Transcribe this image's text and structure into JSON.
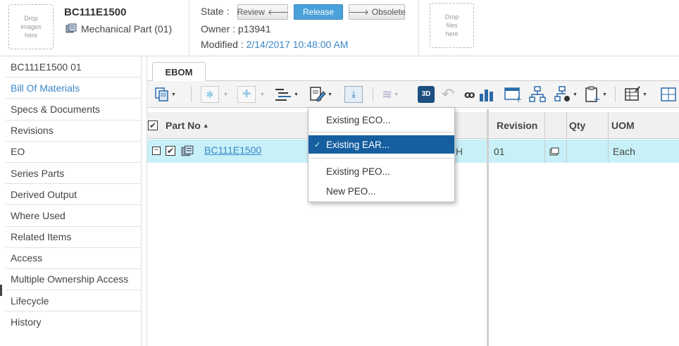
{
  "header": {
    "drop_images": "Drop images here",
    "drop_files": "Drop files here",
    "part_number": "BC111E1500",
    "part_type": "Mechanical Part (01)",
    "state_label": "State :",
    "owner_label": "Owner :",
    "owner_value": "p13941",
    "modified_label": "Modified :",
    "modified_value": "2/14/2017 10:48:00 AM",
    "buttons": {
      "review": "Review",
      "release": "Release",
      "obsolete": "Obsolete"
    }
  },
  "sidebar": {
    "items": [
      {
        "label": "BC111E1500 01"
      },
      {
        "label": "Bill Of Materials"
      },
      {
        "label": "Specs & Documents"
      },
      {
        "label": "Revisions"
      },
      {
        "label": "EO"
      },
      {
        "label": "Series Parts"
      },
      {
        "label": "Derived Output"
      },
      {
        "label": "Where Used"
      },
      {
        "label": "Related Items"
      },
      {
        "label": "Access"
      },
      {
        "label": "Multiple Ownership Access"
      },
      {
        "label": "Lifecycle"
      },
      {
        "label": "History"
      }
    ]
  },
  "tabs": [
    {
      "label": "EBOM"
    }
  ],
  "grid": {
    "columns": {
      "part_no": "Part No",
      "revision": "Revision",
      "qty": "Qty",
      "uom": "UOM"
    },
    "rows": [
      {
        "part_no": "BC111E1500",
        "hidden_fragment": "H",
        "revision": "01",
        "qty": "",
        "uom": "Each"
      }
    ]
  },
  "menu": {
    "items": [
      {
        "label": "Existing ECO..."
      },
      {
        "label": "Existing EAR..."
      },
      {
        "label": "Existing PEO..."
      },
      {
        "label": "New PEO..."
      }
    ]
  },
  "colors": {
    "accent": "#3a87c8",
    "selected_row": "#c8f0f8",
    "menu_selected": "#155fa0",
    "release_button": "#4aa0d8"
  }
}
